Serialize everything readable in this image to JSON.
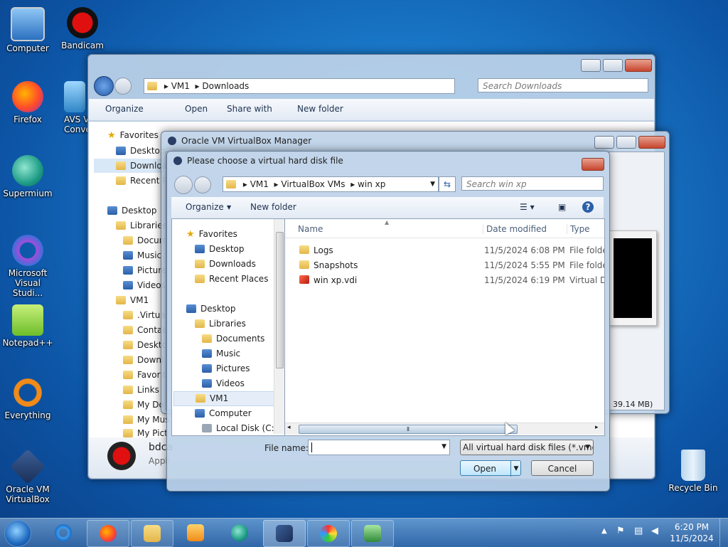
{
  "desktop_icons": [
    {
      "label": "Computer"
    },
    {
      "label": "Bandicam"
    },
    {
      "label": "Firefox"
    },
    {
      "label": "AVS V\nConve"
    },
    {
      "label": "Supermium"
    },
    {
      "label": "Microsoft Visual Studi..."
    },
    {
      "label": "Notepad++"
    },
    {
      "label": "Everything"
    },
    {
      "label": "Oracle VM VirtualBox"
    },
    {
      "label": "Recycle Bin"
    }
  ],
  "explorer": {
    "path": [
      "VM1",
      "Downloads"
    ],
    "search_placeholder": "Search Downloads",
    "toolbar": {
      "organize": "Organize",
      "open": "Open",
      "share": "Share with",
      "new_folder": "New folder"
    },
    "nav": [
      "Favorites",
      "Desktop",
      "Downloads",
      "Recent P",
      "Desktop",
      "Libraries",
      "Docum",
      "Music",
      "Picture",
      "Videos",
      "VM1",
      ".Virtua",
      "Contac",
      "Deskto",
      "Downl",
      "Favorit",
      "Links",
      "My Do",
      "My Mus",
      "My Pict"
    ],
    "status_name": "bdca",
    "status_sub": "Appli"
  },
  "vbox": {
    "title": "Oracle VM VirtualBox Manager",
    "size_text": "39.14 MB)"
  },
  "dialog": {
    "title": "Please choose a virtual hard disk file",
    "path": [
      "VM1",
      "VirtualBox VMs",
      "win xp"
    ],
    "search_placeholder": "Search win xp",
    "toolbar": {
      "organize": "Organize",
      "new_folder": "New folder"
    },
    "nav": {
      "favorites": "Favorites",
      "desktop": "Desktop",
      "downloads": "Downloads",
      "recent": "Recent Places",
      "desktop2": "Desktop",
      "libraries": "Libraries",
      "documents": "Documents",
      "music": "Music",
      "pictures": "Pictures",
      "videos": "Videos",
      "vm1": "VM1",
      "computer": "Computer",
      "local_disk": "Local Disk (C:)"
    },
    "columns": {
      "name": "Name",
      "date": "Date modified",
      "type": "Type"
    },
    "files": [
      {
        "name": "Logs",
        "date": "11/5/2024 6:08 PM",
        "type": "File folder"
      },
      {
        "name": "Snapshots",
        "date": "11/5/2024 5:55 PM",
        "type": "File folder"
      },
      {
        "name": "win xp.vdi",
        "date": "11/5/2024 6:19 PM",
        "type": "Virtual Dis"
      }
    ],
    "file_name_label": "File name:",
    "file_name_value": "",
    "filter": "All virtual hard disk files (*.vmd",
    "open_label": "Open",
    "cancel_label": "Cancel"
  },
  "tray": {
    "time": "6:20 PM",
    "date": "11/5/2024"
  },
  "colors": {
    "desktop": "#1a78c8",
    "accent": "#2b5fa8"
  }
}
